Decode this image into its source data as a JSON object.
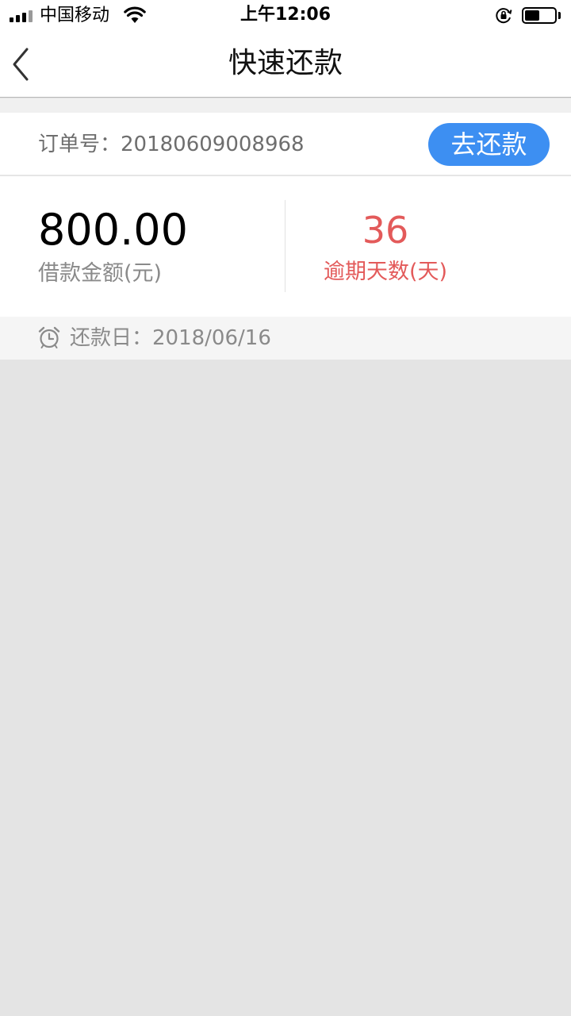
{
  "status_bar": {
    "carrier": "中国移动",
    "time": "上午12:06",
    "battery_level": 0.5,
    "signal_bars": 3
  },
  "nav": {
    "title": "快速还款",
    "back_icon": "chevron-left-icon"
  },
  "order": {
    "label": "订单号：20180609008968",
    "repay_button_label": "去还款",
    "button_color": "#3d8ff2"
  },
  "loan": {
    "amount": "800.00",
    "amount_label": "借款金额(元)",
    "overdue_days": "36",
    "overdue_label": "逾期天数(天)",
    "overdue_color": "#e35a5a"
  },
  "due": {
    "icon": "alarm-clock-icon",
    "text": "还款日：2018/06/16"
  }
}
